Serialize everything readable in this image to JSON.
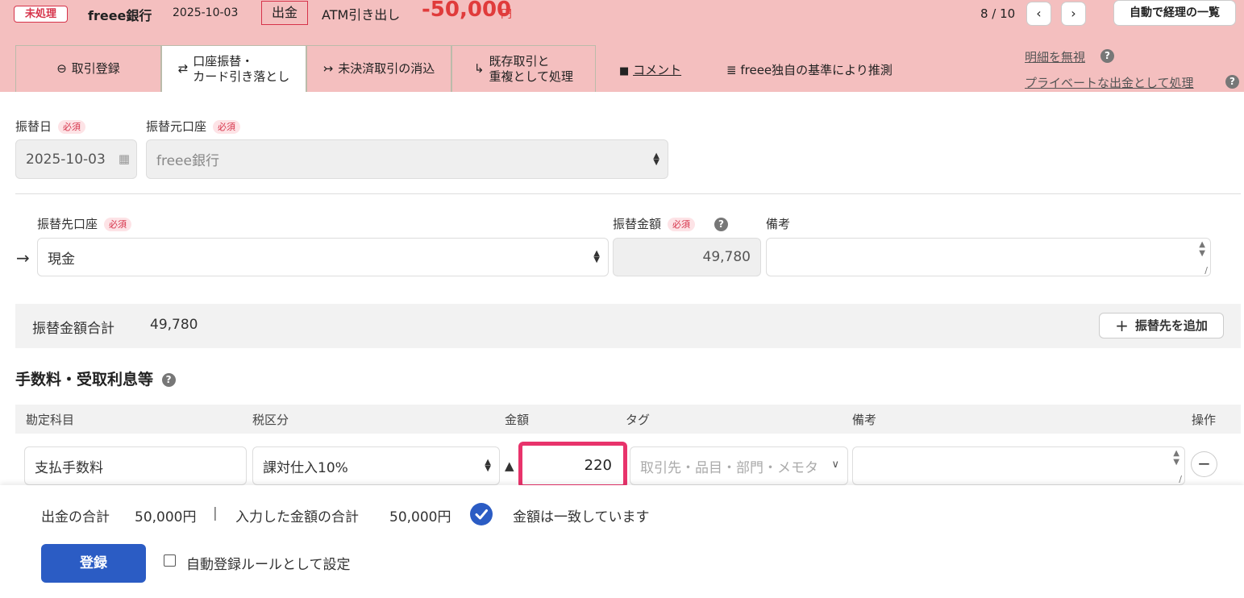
{
  "header": {
    "status_badge": "未処理",
    "bank": "freee銀行",
    "date": "2025-10-03",
    "kind": "出金",
    "description": "ATM引き出し",
    "amount": "-50,000",
    "currency": "円",
    "pager": "8 / 10",
    "list_button": "自動で経理の一覧"
  },
  "tabs": [
    {
      "label": "取引登録"
    },
    {
      "label_line1": "口座振替・",
      "label_line2": "カード引き落とし"
    },
    {
      "label": "未決済取引の消込"
    },
    {
      "label_line1": "既存取引と",
      "label_line2": "重複として処理"
    }
  ],
  "links": {
    "comment": "コメント",
    "inference": "freee独自の基準により推測",
    "ignore": "明細を無視",
    "private": "プライベートな出金として処理"
  },
  "form": {
    "transfer_date_label": "振替日",
    "source_account_label": "振替元口座",
    "required": "必須",
    "transfer_date": "2025-10-03",
    "source_account": "freee銀行",
    "dest_account_label": "振替先口座",
    "amount_label": "振替金額",
    "note_label": "備考",
    "dest_account": "現金",
    "transfer_amount": "49,780",
    "total_label": "振替金額合計",
    "total_value": "49,780",
    "add_dest_button": "振替先を追加"
  },
  "fees": {
    "section_title": "手数料・受取利息等",
    "columns": [
      "勘定科目",
      "税区分",
      "金額",
      "タグ",
      "備考",
      "操作"
    ],
    "row": {
      "account": "支払手数料",
      "tax": "課対仕入10%",
      "sign": "▲",
      "amount": "220",
      "tag_placeholder": "取引先・品目・部門・メモタ"
    }
  },
  "footer": {
    "out_total_label": "出金の合計",
    "out_total": "50,000円",
    "separator": "|",
    "input_total_label": "入力した金額の合計",
    "input_total": "50,000円",
    "match_message": "金額は一致しています",
    "submit": "登録",
    "auto_rule": "自動登録ルールとして設定"
  },
  "colors": {
    "header_bg": "#f4bfbf",
    "accent_red": "#e03b3b",
    "primary_blue": "#2b5cc4",
    "highlight_pink": "#e8336b"
  }
}
